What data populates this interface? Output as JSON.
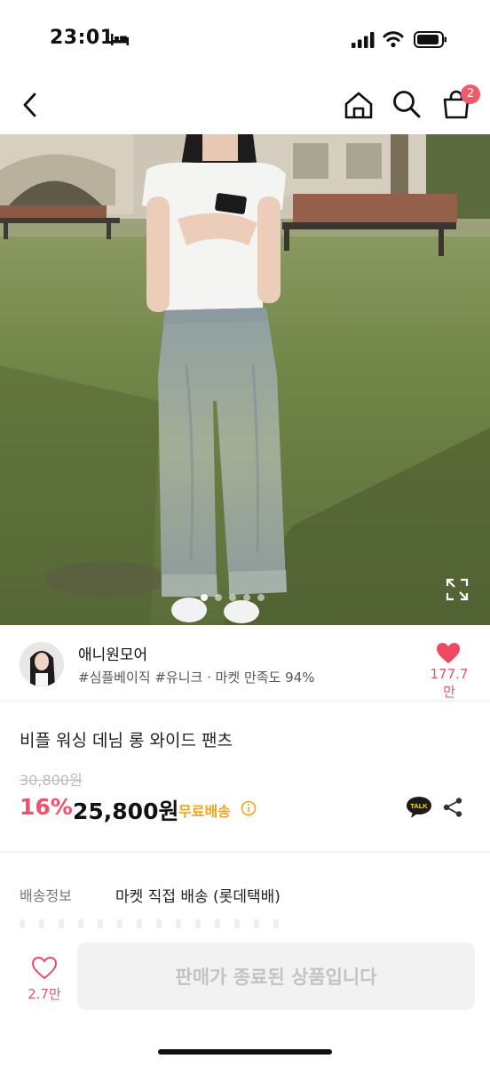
{
  "status_bar": {
    "time": "23:01",
    "icons": [
      "bed-icon",
      "signal-icon",
      "wifi-icon",
      "battery-icon"
    ]
  },
  "nav": {
    "icons": [
      "back-icon",
      "home-icon",
      "search-icon",
      "cart-icon"
    ],
    "cart_badge": "2"
  },
  "gallery": {
    "image": "product photo: person in white top and light-wash wide denim jeans on grass",
    "slide_count": 5,
    "active_slide": 1
  },
  "seller": {
    "name": "애니원모어",
    "tags": "#심플베이직 #유니크 · 마켓 만족도 94%",
    "likes": "177.7만"
  },
  "product": {
    "title": "비플 워싱 데님 롱 와이드 팬츠",
    "original_price": "30,800원",
    "discount": "16%",
    "price": "25,800원",
    "shipping_badge": "무료배송"
  },
  "shipping": {
    "label": "배송정보",
    "value": "마켓 직접 배송 (롯데택배)"
  },
  "bottom_bar": {
    "likes": "2.7만",
    "button_label": "판매가 종료된 상품입니다"
  },
  "colors": {
    "accent_pink": "#f2506a",
    "badge_red": "#f05b6b",
    "free_shipping_orange": "#f3a41a"
  }
}
